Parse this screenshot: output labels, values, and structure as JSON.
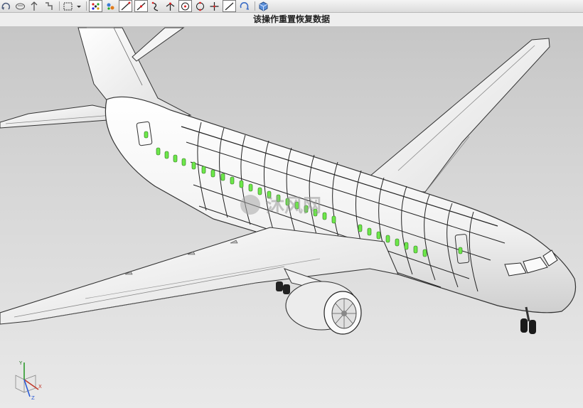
{
  "toolbar": {
    "buttons": [
      {
        "icon": "rotate-icon"
      },
      {
        "icon": "eraser-icon"
      },
      {
        "icon": "pan-icon"
      },
      {
        "icon": "move-icon"
      },
      {
        "icon": "box-select-icon"
      },
      {
        "icon": "dropdown-arrow-icon"
      },
      {
        "icon": "snap-point-icon"
      },
      {
        "icon": "multi-snap-icon"
      },
      {
        "icon": "line-icon"
      },
      {
        "icon": "point-line-icon"
      },
      {
        "icon": "curve-icon"
      },
      {
        "icon": "split-icon"
      },
      {
        "icon": "circle-center-icon"
      },
      {
        "icon": "circle-icon"
      },
      {
        "icon": "cross-icon"
      },
      {
        "icon": "diagonal-icon"
      },
      {
        "icon": "rotate-view-icon"
      },
      {
        "icon": "cube-icon"
      }
    ]
  },
  "status": {
    "message": "该操作重置恢复数据"
  },
  "viewport": {
    "watermark": "沐风网",
    "window_color": "#6de84a",
    "background": "#d6d6d6"
  },
  "triad": {
    "x_label": "X",
    "y_label": "Y",
    "z_label": "Z"
  }
}
